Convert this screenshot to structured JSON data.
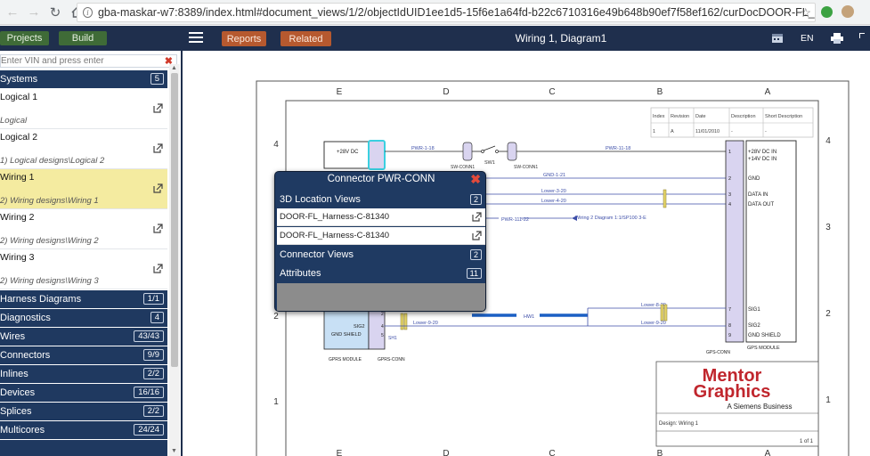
{
  "browser": {
    "url": "gba-maskar-w7:8389/index.html#document_views/1/2/objectIdUID1ee1d5-15f6e1a64fd-b22c6710316e49b648b90ef7f58ef162/curDocDOOR-FL_Harness-C-813..."
  },
  "topbar": {
    "projects_label": "Projects",
    "build_label": "Build",
    "reports_label": "Reports",
    "related_label": "Related",
    "title": "Wiring 1, Diagram1",
    "language": "EN"
  },
  "sidebar": {
    "vin_placeholder": "Enter VIN and press enter",
    "systems": {
      "label": "Systems",
      "count": "5"
    },
    "items": [
      {
        "title": "Logical 1",
        "path": "Logical"
      },
      {
        "title": "Logical 2",
        "path": "1) Logical designs\\Logical 2"
      },
      {
        "title": "Wiring 1",
        "path": "2) Wiring designs\\Wiring 1"
      },
      {
        "title": "Wiring 2",
        "path": "2) Wiring designs\\Wiring 2"
      },
      {
        "title": "Wiring 3",
        "path": "2) Wiring designs\\Wiring 3"
      }
    ],
    "sections": [
      {
        "label": "Harness Diagrams",
        "count": "1/1"
      },
      {
        "label": "Diagnostics",
        "count": "4"
      },
      {
        "label": "Wires",
        "count": "43/43"
      },
      {
        "label": "Connectors",
        "count": "9/9"
      },
      {
        "label": "Inlines",
        "count": "2/2"
      },
      {
        "label": "Devices",
        "count": "16/16"
      },
      {
        "label": "Splices",
        "count": "2/2"
      },
      {
        "label": "Multicores",
        "count": "24/24"
      }
    ]
  },
  "popup": {
    "title": "Connector PWR-CONN",
    "location_views": {
      "label": "3D Location Views",
      "count": "2"
    },
    "links": [
      "DOOR-FL_Harness-C-81340",
      "DOOR-FL_Harness-C-81340"
    ],
    "connector_views": {
      "label": "Connector Views",
      "count": "2"
    },
    "attributes": {
      "label": "Attributes",
      "count": "11"
    }
  },
  "diagram": {
    "col_labels": [
      "E",
      "D",
      "C",
      "B",
      "A"
    ],
    "row_labels_left": [
      "4",
      "2",
      "1"
    ],
    "row_labels_right": [
      "4",
      "3",
      "2",
      "1"
    ],
    "revision_headers": [
      "Index",
      "Revision",
      "Date",
      "Description",
      "Short Description"
    ],
    "revision_row": [
      "1",
      "A",
      "11/01/2010",
      "-",
      "-"
    ],
    "left_box": {
      "label": "+28V DC"
    },
    "right_box": {
      "pins": [
        "1",
        "2",
        "3",
        "4",
        "7",
        "8",
        "9"
      ],
      "labels": [
        "+28V DC IN",
        "+14V DC IN",
        "GND",
        "DATA IN",
        "DATA OUT",
        "SIG1",
        "SIG2",
        "GND SHIELD"
      ],
      "name": "GPS MODULE",
      "conn": "GPS-CONN"
    },
    "bottom_left": {
      "sig": "SIG2",
      "gnd": "GND SHIELD",
      "pins": [
        "2",
        "4",
        "5"
      ],
      "name": "GPRS MODULE",
      "conn": "GPRS-CONN"
    },
    "wires": [
      "PWR-1-18",
      "PWR-11-18",
      "GND-1-21",
      "Lower-3-20",
      "Lower-4-20",
      "PWR-111-22",
      "Lower-9-20",
      "Lower-8-20",
      "Lower-9-20",
      "HW1"
    ],
    "components": [
      "SW-CONN1",
      "SW1",
      "SW-CONN1",
      "SH1"
    ],
    "reference": "Wiring 2 Diagram 1:1/SP100 3-E",
    "logo_line1": "Mentor",
    "logo_line2": "Graphics",
    "logo_tagline": "A Siemens Business",
    "design_label": "Design: Wiring 1",
    "page_label": "1 of 1"
  }
}
